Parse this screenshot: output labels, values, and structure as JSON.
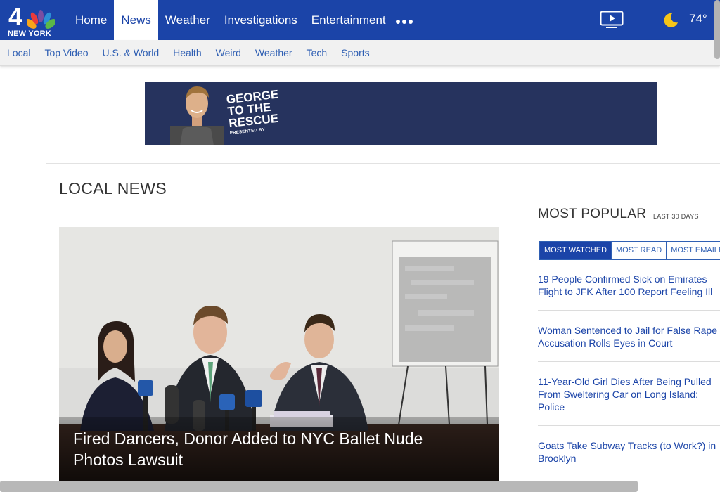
{
  "logo": {
    "number": "4",
    "city": "NEW YORK"
  },
  "nav": {
    "items": [
      "Home",
      "News",
      "Weather",
      "Investigations",
      "Entertainment"
    ],
    "active": "News"
  },
  "subnav": {
    "items": [
      "Local",
      "Top Video",
      "U.S. & World",
      "Health",
      "Weird",
      "Weather",
      "Tech",
      "Sports"
    ]
  },
  "weather": {
    "temperature": "74°"
  },
  "ad": {
    "line1": "George",
    "line2": "to the",
    "line3": "Rescue",
    "tagline": "presented by"
  },
  "section": {
    "title": "LOCAL NEWS"
  },
  "hero": {
    "headline": "Fired Dancers, Donor Added to NYC Ballet Nude Photos Lawsuit"
  },
  "popular": {
    "title": "MOST POPULAR",
    "range": "LAST 30 DAYS",
    "tabs": [
      "MOST WATCHED",
      "MOST READ",
      "MOST EMAILED"
    ],
    "items": [
      [
        "19 People Confirmed Sick on Emirates",
        "Flight to JFK After 100 Report Feeling Ill"
      ],
      [
        "Woman Sentenced to Jail for False Rape",
        "Accusation Rolls Eyes in Court"
      ],
      [
        "11-Year-Old Girl Dies After Being Pulled",
        "From Sweltering Car on Long Island:",
        "Police"
      ],
      [
        "Goats Take Subway Tracks (to Work?) in",
        "Brooklyn"
      ]
    ]
  },
  "colors": {
    "brand": "#1b44a8",
    "link": "#2f5fb3",
    "ad_bg": "#26335e",
    "moon": "#f5c518"
  },
  "icons": [
    "nbc-peacock-icon",
    "more-dots-icon",
    "video-icon",
    "moon-icon"
  ]
}
